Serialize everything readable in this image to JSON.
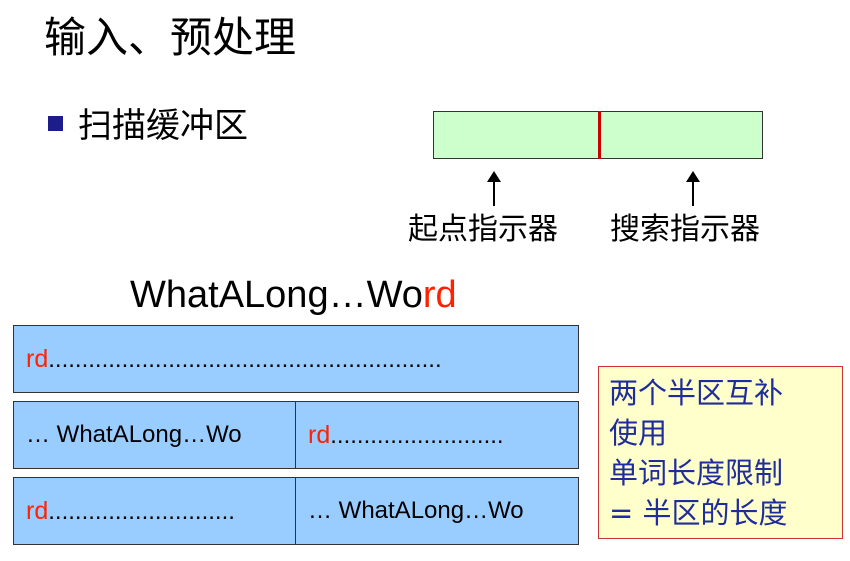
{
  "title": "输入、预处理",
  "bullet": {
    "text": "扫描缓冲区"
  },
  "pointers": {
    "start_label": "起点指示器",
    "search_label": "搜索指示器"
  },
  "word": {
    "black_part": "WhatALong…Wo",
    "red_part": "rd"
  },
  "buffer_rows": [
    {
      "red": "rd",
      "rest": "..........................................................."
    },
    {
      "left": "… WhatALong…Wo",
      "right_red": "rd",
      "right_rest": ".........................."
    },
    {
      "left_red": "rd",
      "left_rest": "............................",
      "right": "… WhatALong…Wo"
    }
  ],
  "note": {
    "lines": [
      "两个半区互补",
      "使用",
      "单词长度限制",
      "= 半区的长度"
    ]
  },
  "colors": {
    "scan_buffer_fill": "#ccffcc",
    "buffer_divider": "#cc0000",
    "buffer_row_fill": "#99ccff",
    "highlight_text": "#ff2200",
    "note_fill": "#ffffcc",
    "note_border": "#cc3333",
    "note_text": "#1f2c9c",
    "bullet": "#1c1c8a"
  },
  "icons": {
    "bullet": "square-bullet-icon",
    "pointer": "up-arrow-icon"
  }
}
